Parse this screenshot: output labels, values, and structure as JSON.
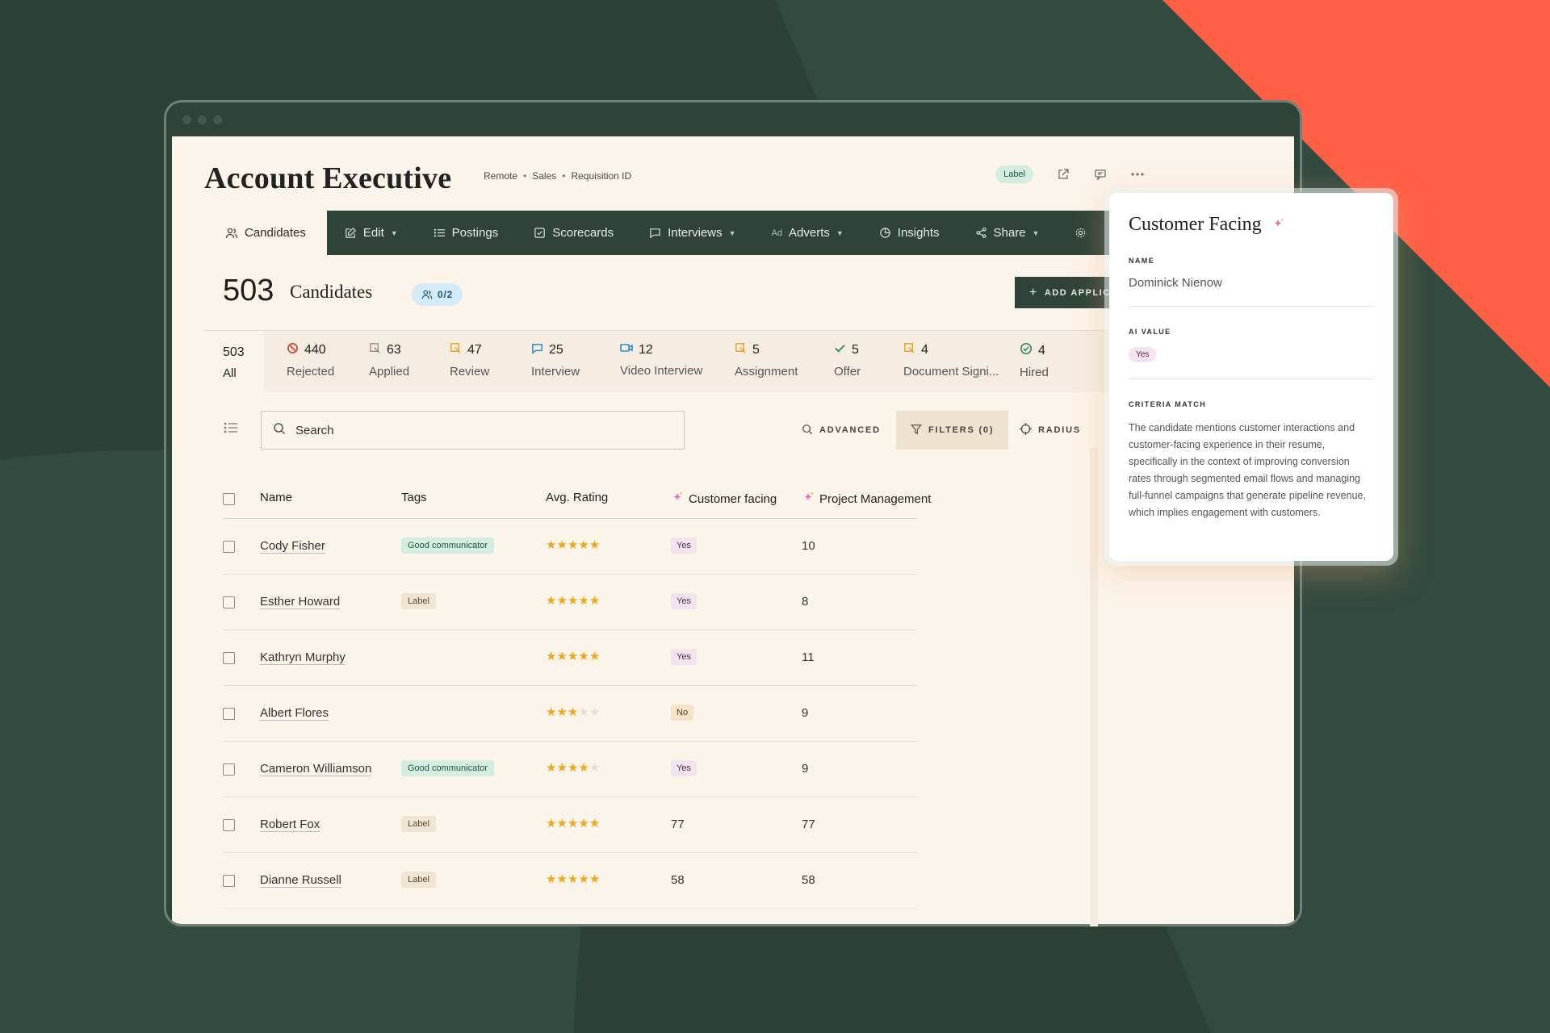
{
  "header": {
    "title": "Account Executive",
    "meta": [
      "Remote",
      "Sales",
      "Requisition ID"
    ],
    "label_badge": "Label"
  },
  "tabs": [
    {
      "label": "Candidates",
      "icon": "users-icon"
    },
    {
      "label": "Edit",
      "icon": "edit-icon"
    },
    {
      "label": "Postings",
      "icon": "list-icon"
    },
    {
      "label": "Scorecards",
      "icon": "checkbox-icon"
    },
    {
      "label": "Interviews",
      "icon": "chat-icon"
    },
    {
      "label": "Adverts",
      "icon": "ad-icon"
    },
    {
      "label": "Insights",
      "icon": "pie-icon"
    },
    {
      "label": "Share",
      "icon": "share-icon"
    }
  ],
  "candidates": {
    "count": "503",
    "label": "Candidates",
    "team_pill": "0/2",
    "add_button": "ADD APPLIC"
  },
  "stages": [
    {
      "num": "503",
      "label": "All"
    },
    {
      "num": "440",
      "label": "Rejected"
    },
    {
      "num": "63",
      "label": "Applied"
    },
    {
      "num": "47",
      "label": "Review"
    },
    {
      "num": "25",
      "label": "Interview"
    },
    {
      "num": "12",
      "label": "Video Interview"
    },
    {
      "num": "5",
      "label": "Assignment"
    },
    {
      "num": "5",
      "label": "Offer"
    },
    {
      "num": "4",
      "label": "Document Signi..."
    },
    {
      "num": "4",
      "label": "Hired"
    }
  ],
  "search": {
    "placeholder": "Search"
  },
  "tools": {
    "advanced": "ADVANCED",
    "filters": "FILTERS (0)",
    "radius": "RADIUS"
  },
  "table": {
    "columns": [
      "Name",
      "Tags",
      "Avg. Rating",
      "Customer facing",
      "Project Management"
    ],
    "rows": [
      {
        "name": "Cody Fisher",
        "tag": "Good communicator",
        "tag_style": "green",
        "rating": 5,
        "cf": "Yes",
        "pm": "10"
      },
      {
        "name": "Esther Howard",
        "tag": "Label",
        "tag_style": "beige",
        "rating": 5,
        "cf": "Yes",
        "pm": "8"
      },
      {
        "name": "Kathryn Murphy",
        "tag": "",
        "tag_style": "",
        "rating": 5,
        "cf": "Yes",
        "pm": "11"
      },
      {
        "name": "Albert Flores",
        "tag": "",
        "tag_style": "",
        "rating": 3,
        "cf": "No",
        "pm": "9"
      },
      {
        "name": "Cameron Williamson",
        "tag": "Good communicator",
        "tag_style": "green",
        "rating": 4,
        "cf": "Yes",
        "pm": "9"
      },
      {
        "name": "Robert Fox",
        "tag": "Label",
        "tag_style": "beige",
        "rating": 5,
        "cf": "77",
        "pm": "77"
      },
      {
        "name": "Dianne Russell",
        "tag": "Label",
        "tag_style": "beige",
        "rating": 5,
        "cf": "58",
        "pm": "58"
      }
    ]
  },
  "card": {
    "title": "Customer Facing",
    "name_label": "NAME",
    "name_value": "Dominick Nienow",
    "ai_label": "AI VALUE",
    "ai_value": "Yes",
    "criteria_label": "CRITERIA MATCH",
    "criteria_text": "The candidate mentions customer interactions and customer-facing experience in their resume, specifically in the context of improving conversion rates through segmented email flows and managing full-funnel campaigns that generate pipeline revenue, which implies engagement with customers."
  },
  "colors": {
    "dark_green": "#2f4339",
    "accent_orange": "#ff5f45",
    "cream": "#fbf4ea",
    "star": "#f0a818"
  }
}
